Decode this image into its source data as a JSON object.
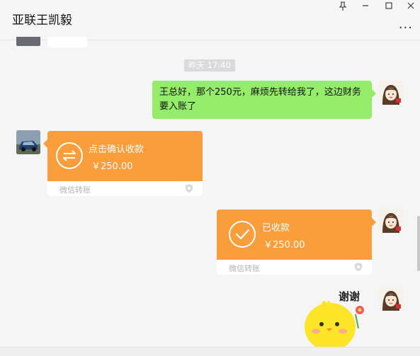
{
  "header": {
    "title": "亚联王凯毅",
    "pin_icon": "pin-icon",
    "minimize_icon": "minimize-icon",
    "maximize_icon": "maximize-icon",
    "close_icon": "close-icon",
    "more_label": "..."
  },
  "chat": {
    "timestamp": "昨天 17:40",
    "sent_message": "王总好，那个250元，麻烦先转给我了，这边财务要入账了",
    "received_transfer": {
      "title": "点击确认收款",
      "amount": "￥250.00",
      "footer": "微信转账"
    },
    "sent_transfer": {
      "title": "已收款",
      "amount": "￥250.00",
      "footer": "微信转账"
    },
    "sticker_text": "谢谢"
  },
  "colors": {
    "green_bubble": "#95ec69",
    "transfer_orange": "#fa9d3b",
    "background": "#f5f5f5"
  }
}
